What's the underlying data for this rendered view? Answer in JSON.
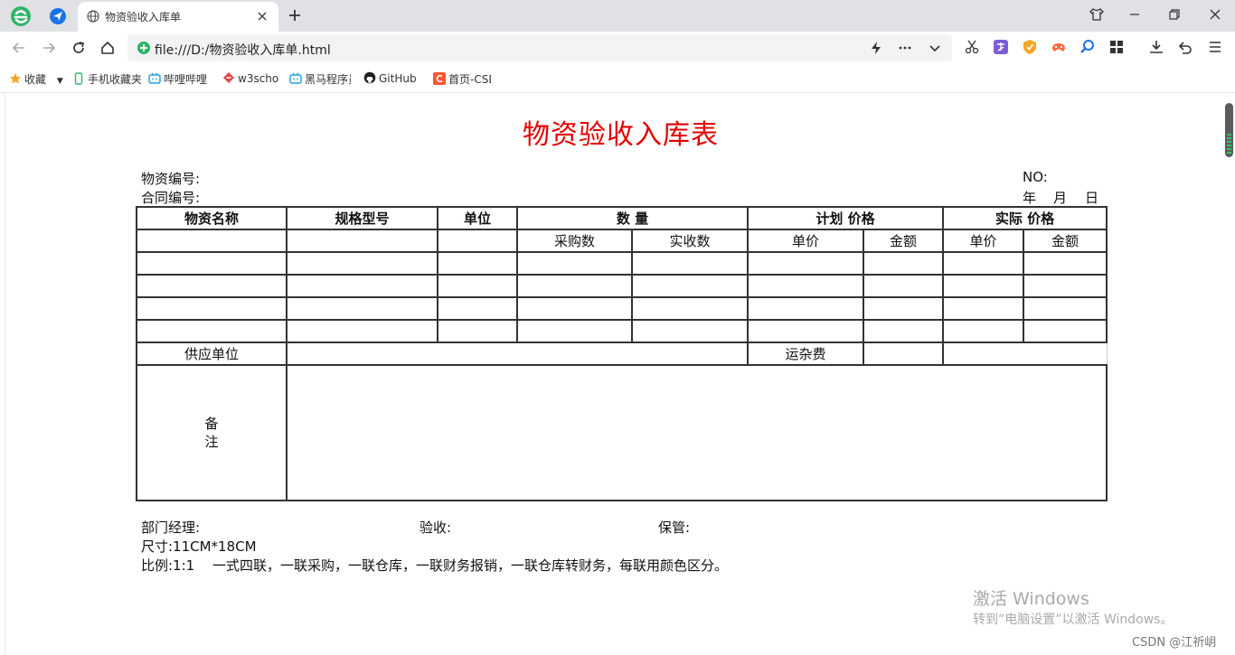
{
  "browser": {
    "tab_title": "物资验收入库单",
    "url": "file:///D:/物资验收入库单.html",
    "bookmarks": [
      {
        "label": "收藏",
        "icon": "star-icon"
      },
      {
        "label": "手机收藏夹",
        "icon": "phone-icon"
      },
      {
        "label": "哔哩哔哩",
        "icon": "bilibili-icon"
      },
      {
        "label": "w3school",
        "icon": "w3school-icon"
      },
      {
        "label": "黑马程序员",
        "icon": "bilibili-icon"
      },
      {
        "label": "GitHub",
        "icon": "github-icon"
      },
      {
        "label": "首页-CSDN",
        "icon": "csdn-icon"
      }
    ]
  },
  "form": {
    "title": "物资验收入库表",
    "material_no_label": "物资编号:",
    "contract_no_label": "合同编号:",
    "no_label": "NO:",
    "date_year": "年",
    "date_month": "月",
    "date_day": "日",
    "headers": {
      "name": "物资名称",
      "spec": "规格型号",
      "unit": "单位",
      "quantity": "数 量",
      "planned_price": "计划 价格",
      "actual_price": "实际 价格"
    },
    "subheaders": {
      "purchase_qty": "采购数",
      "received_qty": "实收数",
      "plan_unit_price": "单价",
      "plan_amount": "金额",
      "actual_unit_price": "单价",
      "actual_amount": "金额"
    },
    "supplier_label": "供应单位",
    "freight_label": "运杂费",
    "remarks_label": "备注",
    "dept_manager_label": "部门经理:",
    "inspector_label": "验收:",
    "keeper_label": "保管:",
    "size_text": "尺寸:11CM*18CM",
    "ratio_text": "比例:1:1　 一式四联，一联采购，一联仓库，一联财务报销，一联仓库转财务，每联用颜色区分。"
  },
  "overlay": {
    "activate_title": "激活 Windows",
    "activate_hint": "转到“电脑设置”以激活 Windows。",
    "csdn_credit": "CSDN @江祈岄"
  },
  "colors": {
    "title_red": "#e30000",
    "chrome_gray": "#dfe1e5",
    "border": "#333333"
  }
}
